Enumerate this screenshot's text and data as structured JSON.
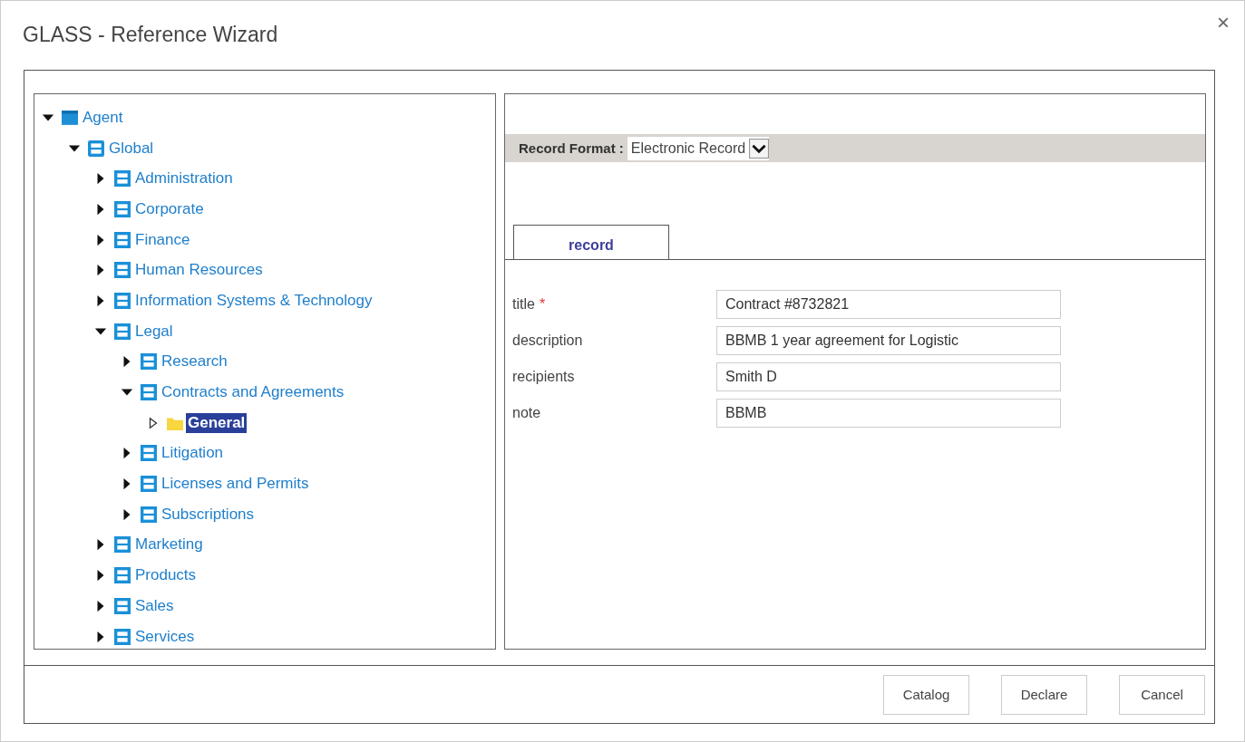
{
  "window": {
    "title": "GLASS - Reference Wizard",
    "close": "×"
  },
  "tree": [
    {
      "label": "Agent",
      "kind": "root",
      "expanded": true,
      "selected": false,
      "children": [
        {
          "label": "Global",
          "kind": "group",
          "expanded": true,
          "selected": false,
          "children": [
            {
              "label": "Administration",
              "kind": "cabinet",
              "expanded": false,
              "selected": false
            },
            {
              "label": "Corporate",
              "kind": "cabinet",
              "expanded": false,
              "selected": false
            },
            {
              "label": "Finance",
              "kind": "cabinet",
              "expanded": false,
              "selected": false
            },
            {
              "label": "Human Resources",
              "kind": "cabinet",
              "expanded": false,
              "selected": false
            },
            {
              "label": "Information Systems & Technology",
              "kind": "cabinet",
              "expanded": false,
              "selected": false
            },
            {
              "label": "Legal",
              "kind": "cabinet",
              "expanded": true,
              "selected": false,
              "children": [
                {
                  "label": "Research",
                  "kind": "cabinet",
                  "expanded": false,
                  "selected": false
                },
                {
                  "label": "Contracts and Agreements",
                  "kind": "cabinet",
                  "expanded": true,
                  "selected": false,
                  "children": [
                    {
                      "label": "General",
                      "kind": "folder",
                      "expanded": false,
                      "selected": true
                    }
                  ]
                },
                {
                  "label": "Litigation",
                  "kind": "cabinet",
                  "expanded": false,
                  "selected": false
                },
                {
                  "label": "Licenses and Permits",
                  "kind": "cabinet",
                  "expanded": false,
                  "selected": false
                },
                {
                  "label": "Subscriptions",
                  "kind": "cabinet",
                  "expanded": false,
                  "selected": false
                }
              ]
            },
            {
              "label": "Marketing",
              "kind": "cabinet",
              "expanded": false,
              "selected": false
            },
            {
              "label": "Products",
              "kind": "cabinet",
              "expanded": false,
              "selected": false
            },
            {
              "label": "Sales",
              "kind": "cabinet",
              "expanded": false,
              "selected": false
            },
            {
              "label": "Services",
              "kind": "cabinet",
              "expanded": false,
              "selected": false
            }
          ]
        }
      ]
    }
  ],
  "record_format": {
    "label": "Record Format :",
    "value": "Electronic Record"
  },
  "tabs": [
    {
      "label": "record",
      "selected": true
    }
  ],
  "fields": [
    {
      "label": "title",
      "required_mark": "*",
      "value": "Contract #8732821"
    },
    {
      "label": "description",
      "value": "BBMB 1 year agreement for Logistic"
    },
    {
      "label": "recipients",
      "value": "Smith D"
    },
    {
      "label": "note",
      "value": "BBMB"
    }
  ],
  "buttons": [
    "Catalog",
    "Declare",
    "Cancel"
  ]
}
